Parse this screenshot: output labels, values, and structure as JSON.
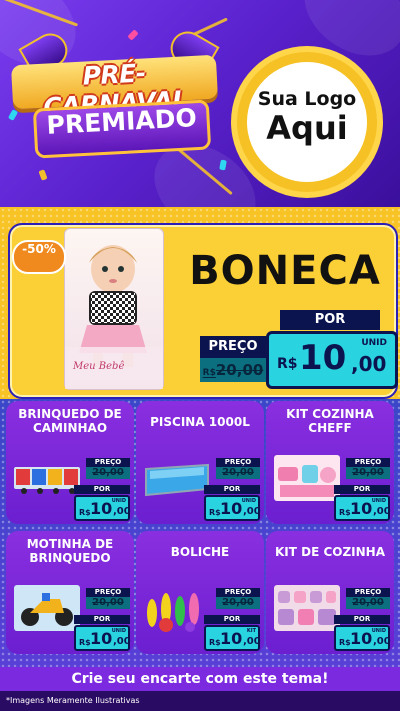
{
  "header": {
    "title_line1": "PRÉ-CARNAVAL",
    "title_line2": "PREMIADO",
    "logo_line1": "Sua Logo",
    "logo_line2": "Aqui"
  },
  "featured": {
    "discount_badge": "-50%",
    "name": "BONECA",
    "box_text": "Meu Bebê",
    "price_label": "PREÇO",
    "old_price": "20,00",
    "por_label": "POR",
    "currency": "R$",
    "price_int": "10",
    "price_cents": ",00",
    "unit": "UNID"
  },
  "products": [
    {
      "name": "BRINQUEDO DE CAMINHAO",
      "price_label": "PREÇO",
      "old_price": "20,00",
      "por_label": "POR",
      "currency": "R$",
      "price_int": "10",
      "price_cents": ",00",
      "unit": "UNID"
    },
    {
      "name": "PISCINA 1000L",
      "price_label": "PREÇO",
      "old_price": "20,00",
      "por_label": "POR",
      "currency": "R$",
      "price_int": "10",
      "price_cents": ",00",
      "unit": "UNID"
    },
    {
      "name": "KIT COZINHA CHEFF",
      "price_label": "PREÇO",
      "old_price": "20,00",
      "por_label": "POR",
      "currency": "R$",
      "price_int": "10",
      "price_cents": ",00",
      "unit": "UNID"
    },
    {
      "name": "MOTINHA DE BRINQUEDO",
      "price_label": "PREÇO",
      "old_price": "20,00",
      "por_label": "POR",
      "currency": "R$",
      "price_int": "10",
      "price_cents": ",00",
      "unit": "UNID"
    },
    {
      "name": "BOLICHE",
      "price_label": "PREÇO",
      "old_price": "20,00",
      "por_label": "POR",
      "currency": "R$",
      "price_int": "10",
      "price_cents": ",00",
      "unit": "KIT"
    },
    {
      "name": "KIT DE COZINHA",
      "price_label": "PREÇO",
      "old_price": "20,00",
      "por_label": "POR",
      "currency": "R$",
      "price_int": "10",
      "price_cents": ",00",
      "unit": "UNID"
    }
  ],
  "footer": {
    "cta": "Crie seu encarte com este tema!",
    "disclaimer": "*Imagens Meramente Ilustrativas"
  },
  "colors": {
    "header_purple": "#5b22cf",
    "gold": "#f7c325",
    "price_cyan": "#29d3e0",
    "navy": "#0c1450",
    "card_purple": "#7a28d8"
  }
}
